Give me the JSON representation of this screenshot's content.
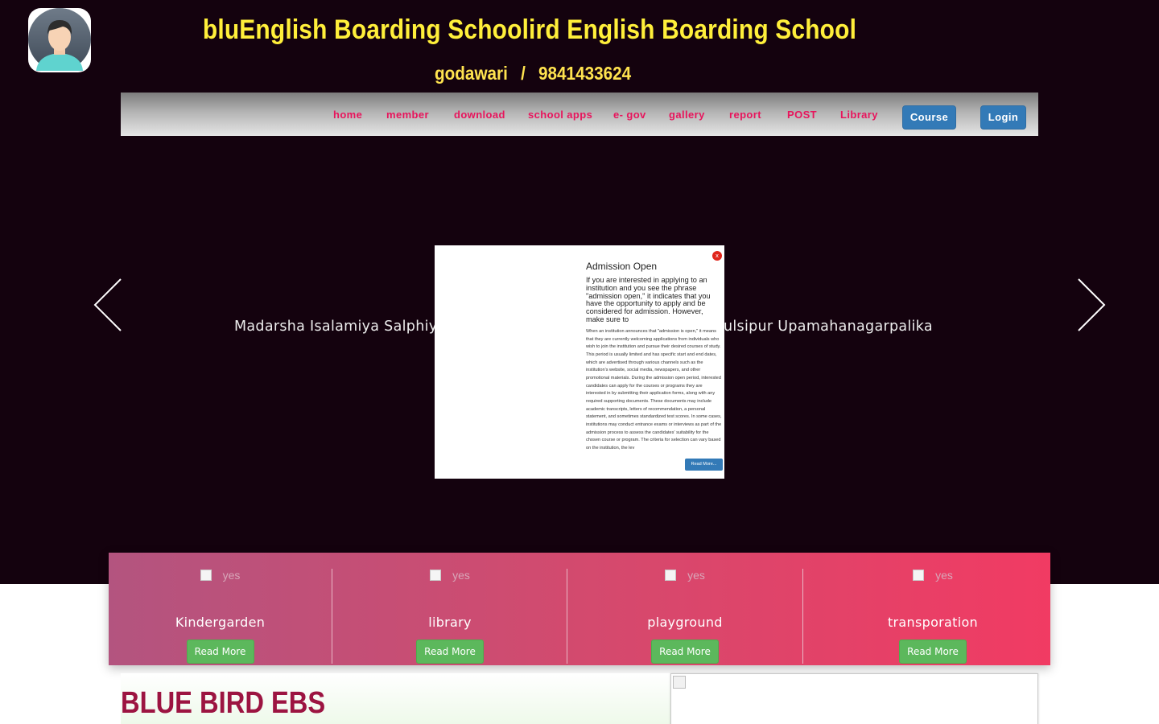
{
  "header": {
    "school_name": "bluEnglish Boarding Schoolird English Boarding School",
    "location": "godawari",
    "separator": "/",
    "phone": "9841433624"
  },
  "nav": {
    "links": [
      "home",
      "member",
      "download",
      "school apps",
      "e- gov",
      "gallery",
      "report",
      "POST",
      "Library"
    ],
    "course_label": "Course",
    "login_label": "Login"
  },
  "slider": {
    "left_text": "Madarsha Isalamiya Salphiya",
    "right_text": "ulsipur Upamahanagarpalika"
  },
  "modal": {
    "close_label": "x",
    "title": "Admission Open",
    "lead": "If you are interested in applying to an institution and you see the phrase \"admission open,\" it indicates that you have the opportunity to apply and be considered for admission. However, make sure to",
    "body": "When an institution announces that \"admission is open,\" it means that they are currently welcoming applications from individuals who wish to join the institution and pursue their desired courses of study. This period is usually limited and has specific start and end dates, which are advertised through various channels such as the institution's website, social media, newspapers, and other promotional materials. During the admission open period, interested candidates can apply for the courses or programs they are interested in by submitting their application forms, along with any required supporting documents. These documents may include academic transcripts, letters of recommendation, a personal statement, and sometimes standardized test scores. In some cases, institutions may conduct entrance exams or interviews as part of the admission process to assess the candidates' suitability for the chosen course or program. The criteria for selection can vary based on the institution, the lev",
    "read_more": "Read More..."
  },
  "features": [
    {
      "img_alt": "yes",
      "title": "Kindergarden",
      "button": "Read More"
    },
    {
      "img_alt": "yes",
      "title": "library",
      "button": "Read More"
    },
    {
      "img_alt": "yes",
      "title": "playground",
      "button": "Read More"
    },
    {
      "img_alt": "yes",
      "title": "transporation",
      "button": "Read More"
    }
  ],
  "about": {
    "title": "BLUE BIRD EBS"
  },
  "icons": {
    "avatar": "user-avatar-icon",
    "prev": "arrow-left-icon",
    "next": "arrow-right-icon",
    "broken_image": "broken-image-icon"
  },
  "colors": {
    "hero_bg": "#14020e",
    "title_yellow": "#ffef3a",
    "nav_link": "#e8145c",
    "primary_button": "#337ab7",
    "success_button": "#5cb85c",
    "features_gradient_start": "#b3547f",
    "features_gradient_end": "#f13b63",
    "about_title": "#9c1441"
  }
}
